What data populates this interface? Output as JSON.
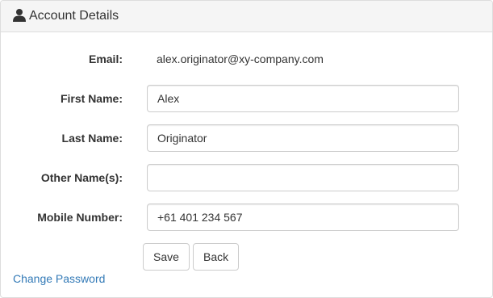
{
  "panel": {
    "title": "Account Details",
    "icon": "user-icon"
  },
  "form": {
    "email": {
      "label": "Email:",
      "value": "alex.originator@xy-company.com"
    },
    "first_name": {
      "label": "First Name:",
      "value": "Alex"
    },
    "last_name": {
      "label": "Last Name:",
      "value": "Originator"
    },
    "other_names": {
      "label": "Other Name(s):",
      "value": ""
    },
    "mobile": {
      "label": "Mobile Number:",
      "value": "+61 401 234 567"
    }
  },
  "actions": {
    "save_label": "Save",
    "back_label": "Back",
    "change_password_label": "Change Password"
  },
  "colors": {
    "link": "#337ab7",
    "heading_bg": "#f5f5f5",
    "border": "#cccccc"
  }
}
